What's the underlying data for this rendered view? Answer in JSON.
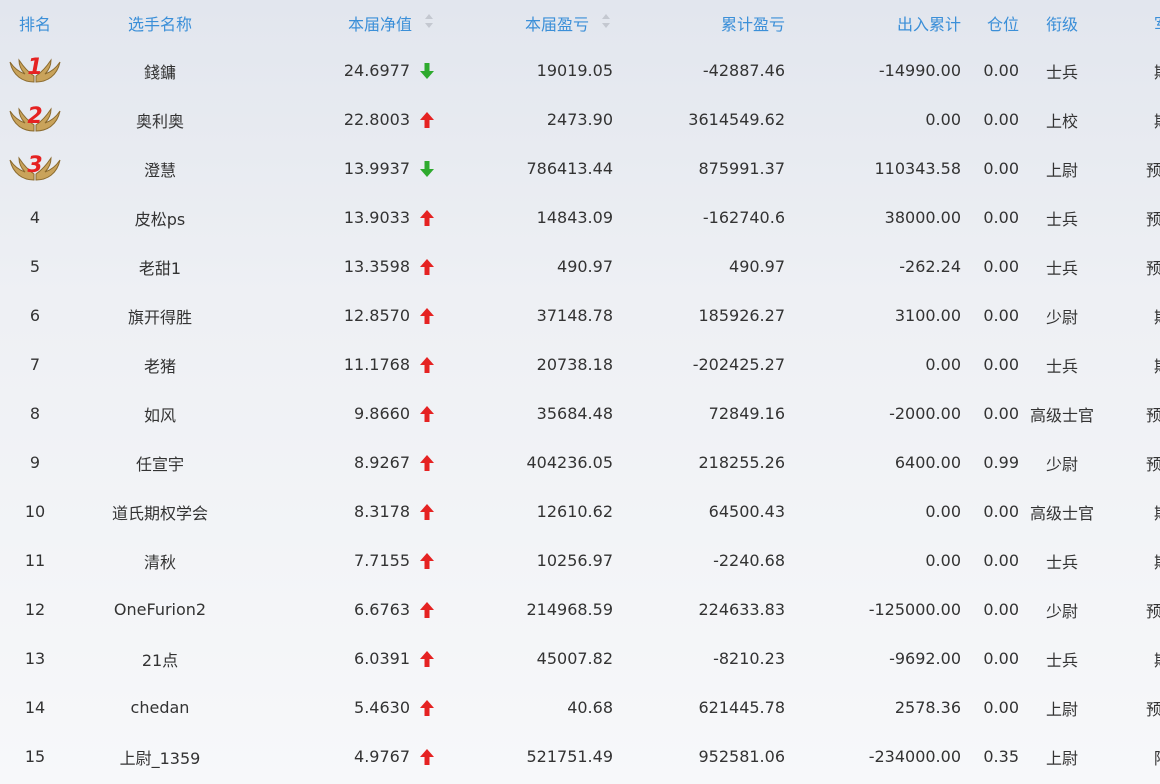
{
  "headers": {
    "rank": "排名",
    "name": "选手名称",
    "nav": "本届净值",
    "profit": "本届盈亏",
    "cumulative": "累计盈亏",
    "flow": "出入累计",
    "position": "仓位",
    "level": "衔级",
    "branch": "军种"
  },
  "colors": {
    "header_text": "#3b8fd8",
    "up_arrow": "#e52222",
    "down_arrow": "#2eaa2e",
    "medal_number": "#e52222"
  },
  "rows": [
    {
      "rank": "1",
      "medal": true,
      "name": "錢鏞",
      "nav": "24.6977",
      "trend": "down",
      "profit": "19019.05",
      "cumulative": "-42887.46",
      "flow": "-14990.00",
      "position": "0.00",
      "level": "士兵",
      "branch": "期权"
    },
    {
      "rank": "2",
      "medal": true,
      "name": "奥利奥",
      "nav": "22.8003",
      "trend": "up",
      "profit": "2473.90",
      "cumulative": "3614549.62",
      "flow": "0.00",
      "position": "0.00",
      "level": "上校",
      "branch": "期权"
    },
    {
      "rank": "3",
      "medal": true,
      "name": "澄慧",
      "nav": "13.9937",
      "trend": "down",
      "profit": "786413.44",
      "cumulative": "875991.37",
      "flow": "110343.58",
      "position": "0.00",
      "level": "上尉",
      "branch": "预备役"
    },
    {
      "rank": "4",
      "medal": false,
      "name": "皮松ps",
      "nav": "13.9033",
      "trend": "up",
      "profit": "14843.09",
      "cumulative": "-162740.6",
      "flow": "38000.00",
      "position": "0.00",
      "level": "士兵",
      "branch": "预备役"
    },
    {
      "rank": "5",
      "medal": false,
      "name": "老甜1",
      "nav": "13.3598",
      "trend": "up",
      "profit": "490.97",
      "cumulative": "490.97",
      "flow": "-262.24",
      "position": "0.00",
      "level": "士兵",
      "branch": "预备役"
    },
    {
      "rank": "6",
      "medal": false,
      "name": "旗开得胜",
      "nav": "12.8570",
      "trend": "up",
      "profit": "37148.78",
      "cumulative": "185926.27",
      "flow": "3100.00",
      "position": "0.00",
      "level": "少尉",
      "branch": "期权"
    },
    {
      "rank": "7",
      "medal": false,
      "name": "老猪",
      "nav": "11.1768",
      "trend": "up",
      "profit": "20738.18",
      "cumulative": "-202425.27",
      "flow": "0.00",
      "position": "0.00",
      "level": "士兵",
      "branch": "期权"
    },
    {
      "rank": "8",
      "medal": false,
      "name": "如风",
      "nav": "9.8660",
      "trend": "up",
      "profit": "35684.48",
      "cumulative": "72849.16",
      "flow": "-2000.00",
      "position": "0.00",
      "level": "高级士官",
      "branch": "预备役"
    },
    {
      "rank": "9",
      "medal": false,
      "name": "任宣宇",
      "nav": "8.9267",
      "trend": "up",
      "profit": "404236.05",
      "cumulative": "218255.26",
      "flow": "6400.00",
      "position": "0.99",
      "level": "少尉",
      "branch": "预备役"
    },
    {
      "rank": "10",
      "medal": false,
      "name": "道氏期权学会",
      "nav": "8.3178",
      "trend": "up",
      "profit": "12610.62",
      "cumulative": "64500.43",
      "flow": "0.00",
      "position": "0.00",
      "level": "高级士官",
      "branch": "期权"
    },
    {
      "rank": "11",
      "medal": false,
      "name": "清秋",
      "nav": "7.7155",
      "trend": "up",
      "profit": "10256.97",
      "cumulative": "-2240.68",
      "flow": "0.00",
      "position": "0.00",
      "level": "士兵",
      "branch": "期权"
    },
    {
      "rank": "12",
      "medal": false,
      "name": "OneFurion2",
      "nav": "6.6763",
      "trend": "up",
      "profit": "214968.59",
      "cumulative": "224633.83",
      "flow": "-125000.00",
      "position": "0.00",
      "level": "少尉",
      "branch": "预备役"
    },
    {
      "rank": "13",
      "medal": false,
      "name": "21点",
      "nav": "6.0391",
      "trend": "up",
      "profit": "45007.82",
      "cumulative": "-8210.23",
      "flow": "-9692.00",
      "position": "0.00",
      "level": "士兵",
      "branch": "期权"
    },
    {
      "rank": "14",
      "medal": false,
      "name": "chedan",
      "nav": "5.4630",
      "trend": "up",
      "profit": "40.68",
      "cumulative": "621445.78",
      "flow": "2578.36",
      "position": "0.00",
      "level": "上尉",
      "branch": "预备役"
    },
    {
      "rank": "15",
      "medal": false,
      "name": "上尉_1359",
      "nav": "4.9767",
      "trend": "up",
      "profit": "521751.49",
      "cumulative": "952581.06",
      "flow": "-234000.00",
      "position": "0.35",
      "level": "上尉",
      "branch": "陆军"
    }
  ]
}
